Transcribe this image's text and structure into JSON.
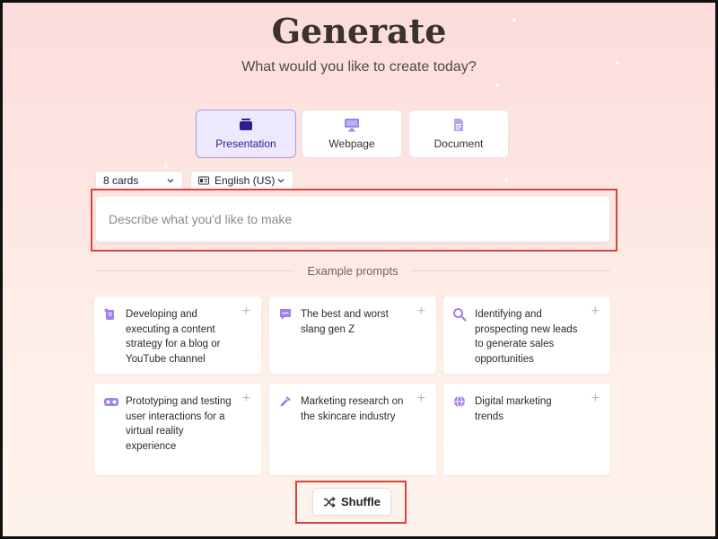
{
  "header": {
    "title": "Generate",
    "subtitle": "What would you like to create today?"
  },
  "content_types": [
    {
      "label": "Presentation",
      "icon": "presentation-icon",
      "selected": true
    },
    {
      "label": "Webpage",
      "icon": "monitor-icon",
      "selected": false
    },
    {
      "label": "Document",
      "icon": "document-icon",
      "selected": false
    }
  ],
  "options": {
    "cards": "8 cards",
    "language": "English (US)"
  },
  "prompt": {
    "placeholder": "Describe what you'd like to make",
    "value": ""
  },
  "examples": {
    "heading": "Example prompts",
    "items": [
      {
        "text": "Developing and executing a content strategy for a blog or YouTube channel",
        "icon": "scroll-icon"
      },
      {
        "text": "The best and worst slang gen Z",
        "icon": "chat-icon"
      },
      {
        "text": "Identifying and prospecting new leads to generate sales opportunities",
        "icon": "search-icon"
      },
      {
        "text": "Prototyping and testing user interactions for a virtual reality experience",
        "icon": "vr-headset-icon"
      },
      {
        "text": "Marketing research on the skincare industry",
        "icon": "dropper-icon"
      },
      {
        "text": "Digital marketing trends",
        "icon": "globe-icon"
      }
    ]
  },
  "shuffle": {
    "label": "Shuffle",
    "icon": "shuffle-icon"
  },
  "colors": {
    "accent": "#a27ef0",
    "selected_bg": "#ede8fb",
    "highlight": "#d9433e"
  }
}
